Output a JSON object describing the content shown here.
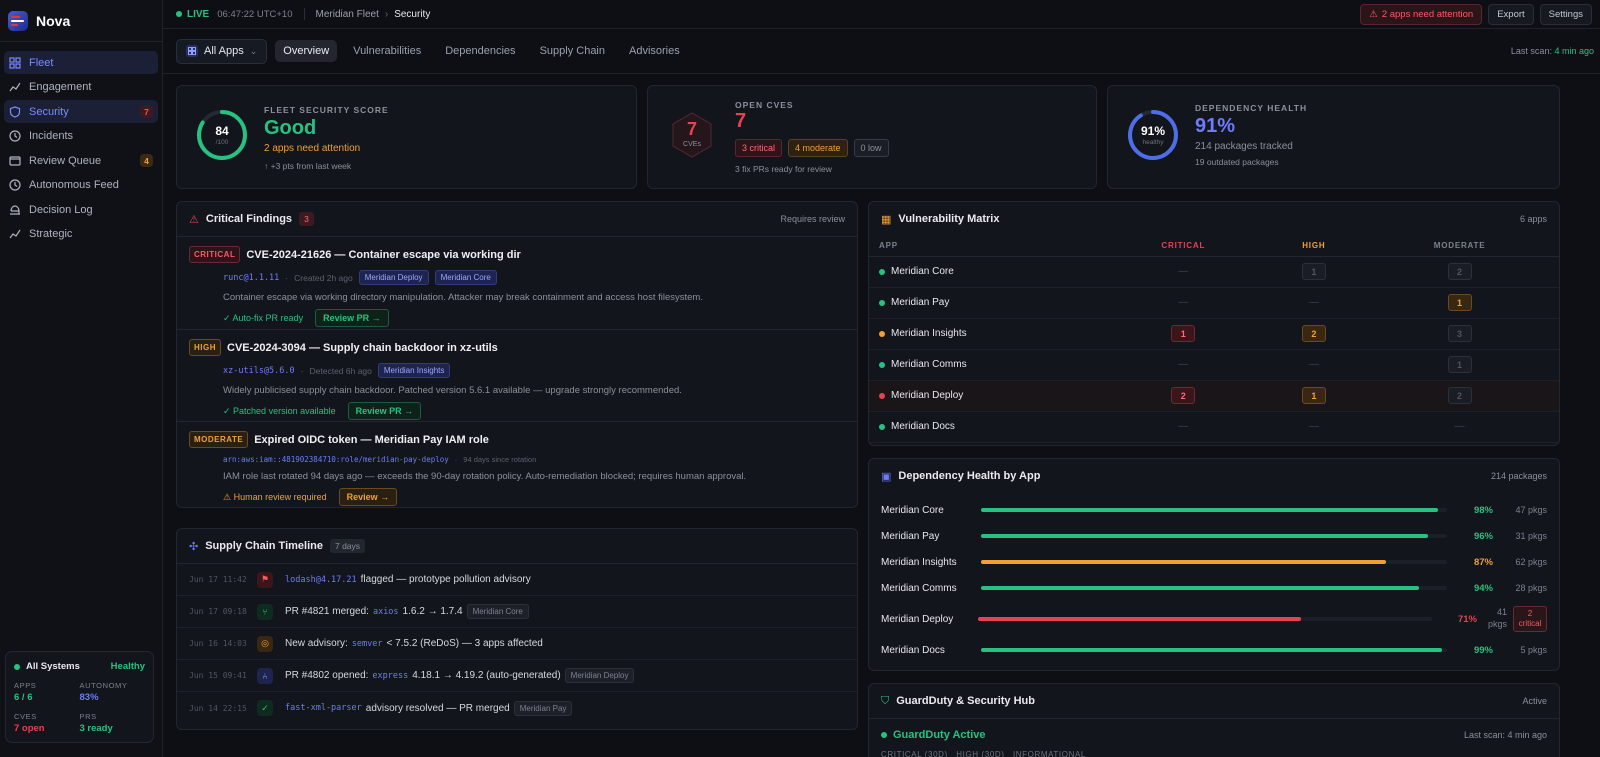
{
  "sidebar": {
    "brand": "Nova",
    "items": [
      {
        "label": "Fleet",
        "icon": "grid-icon",
        "active": true
      },
      {
        "label": "Engagement",
        "icon": "trend-icon"
      },
      {
        "label": "Security",
        "icon": "shield-icon",
        "badge": "7"
      },
      {
        "label": "Incidents",
        "icon": "clock-icon"
      },
      {
        "label": "Review Queue",
        "icon": "inbox-icon",
        "badge": "4"
      },
      {
        "label": "Autonomous Feed",
        "icon": "clock-icon"
      },
      {
        "label": "Decision Log",
        "icon": "scale-icon"
      },
      {
        "label": "Strategic",
        "icon": "trend-icon"
      }
    ],
    "systems": {
      "title": "All Systems",
      "status": "Healthy",
      "apps_label": "APPS",
      "apps": "6 / 6",
      "autonomy_label": "AUTONOMY",
      "autonomy": "83%",
      "cves_label": "CVES",
      "cves": "7 open",
      "prs_label": "PRS",
      "prs": "3 ready"
    }
  },
  "topbar": {
    "live": "LIVE",
    "time": "06:47:22 UTC+10",
    "crumb1": "Meridian Fleet",
    "crumb2": "Security",
    "attention": "2 apps need attention",
    "export": "Export",
    "settings": "Settings"
  },
  "tabs": {
    "selector": "All Apps",
    "items": [
      "Overview",
      "Vulnerabilities",
      "Dependencies",
      "Supply Chain",
      "Advisories"
    ],
    "last_scan_label": "Last scan:",
    "last_scan": "4 min ago"
  },
  "score": {
    "label": "FLEET SECURITY SCORE",
    "value": "Good",
    "sub": "2 apps need attention",
    "note": "↑ +3 pts from last week",
    "gauge": "84",
    "gauge_sub": "/100",
    "fraction": 0.84
  },
  "cves": {
    "label": "OPEN CVES",
    "value": "7",
    "hex": "7",
    "hex_sub": "CVEs",
    "critical": "3 critical",
    "moderate": "4 moderate",
    "low": "0 low",
    "note": "3 fix PRs ready for review"
  },
  "deps": {
    "label": "DEPENDENCY HEALTH",
    "value": "91%",
    "sub": "214 packages tracked",
    "note": "19 outdated packages",
    "gauge": "91%",
    "gauge_sub": "healthy",
    "fraction": 0.91
  },
  "findings": {
    "title": "Critical Findings",
    "count": "3",
    "right": "Requires review",
    "items": [
      {
        "sev": "CRITICAL",
        "title": "CVE-2024-21626 — Container escape via working dir",
        "pkg": "runc@1.1.11",
        "time": "Created 2h ago",
        "tags": [
          "Meridian Deploy",
          "Meridian Core"
        ],
        "desc": "Container escape via working directory manipulation. Attacker may break containment and access host filesystem.",
        "status": "✓ Auto-fix PR ready",
        "action": "Review PR →"
      },
      {
        "sev": "HIGH",
        "title": "CVE-2024-3094 — Supply chain backdoor in xz-utils",
        "pkg": "xz-utils@5.6.0",
        "time": "Detected 6h ago",
        "tags": [
          "Meridian Insights"
        ],
        "desc": "Widely publicised supply chain backdoor. Patched version 5.6.1 available — upgrade strongly recommended.",
        "status": "✓ Patched version available",
        "action": "Review PR →"
      },
      {
        "sev": "MODERATE",
        "title": "Expired OIDC token — Meridian Pay IAM role",
        "pkg": "arn:aws:iam::481902384710:role/meridian-pay-deploy",
        "time": "94 days since rotation",
        "tags": [],
        "desc": "IAM role last rotated 94 days ago — exceeds the 90-day rotation policy. Auto-remediation blocked; requires human approval.",
        "status": "⚠ Human review required",
        "action": "Review →"
      }
    ]
  },
  "timeline": {
    "title": "Supply Chain Timeline",
    "badge": "7 days",
    "rows": [
      {
        "time": "Jun 17 11:42",
        "pkg": "lodash@4.17.21",
        "text": "flagged — prototype pollution advisory",
        "tag": ""
      },
      {
        "time": "Jun 17 09:18",
        "pre": "PR #4821 merged:",
        "pkg": "axios",
        "text": "1.6.2 → 1.7.4",
        "tag": "Meridian Core"
      },
      {
        "time": "Jun 16 14:03",
        "pre": "New advisory:",
        "pkg": "semver",
        "text": "< 7.5.2 (ReDoS) — 3 apps affected",
        "tag": ""
      },
      {
        "time": "Jun 15 09:41",
        "pre": "PR #4802 opened:",
        "pkg": "express",
        "text": "4.18.1 → 4.19.2 (auto-generated)",
        "tag": "Meridian Deploy"
      },
      {
        "time": "Jun 14 22:15",
        "pkg": "fast-xml-parser",
        "text": "advisory resolved — PR merged",
        "tag": "Meridian Pay"
      }
    ]
  },
  "matrix": {
    "title": "Vulnerability Matrix",
    "right": "6 apps",
    "cols": [
      "APP",
      "CRITICAL",
      "HIGH",
      "MODERATE"
    ],
    "rows": [
      {
        "app": "Meridian Core",
        "dot": "#27c281",
        "c": "—",
        "h": "1",
        "m": "2"
      },
      {
        "app": "Meridian Pay",
        "dot": "#27c281",
        "c": "—",
        "h": "—",
        "m": "1"
      },
      {
        "app": "Meridian Insights",
        "dot": "#f3a032",
        "c": "1",
        "h": "2",
        "m": "3"
      },
      {
        "app": "Meridian Comms",
        "dot": "#27c281",
        "c": "—",
        "h": "—",
        "m": "1"
      },
      {
        "app": "Meridian Deploy",
        "dot": "#e8424f",
        "c": "2",
        "h": "1",
        "m": "2"
      },
      {
        "app": "Meridian Docs",
        "dot": "#27c281",
        "c": "—",
        "h": "—",
        "m": "—"
      }
    ]
  },
  "dephealth": {
    "title": "Dependency Health by App",
    "right": "214 packages",
    "rows": [
      {
        "app": "Meridian Core",
        "pct": "98%",
        "value": 98,
        "pkgs": "47 pkgs",
        "color": "#27c281"
      },
      {
        "app": "Meridian Pay",
        "pct": "96%",
        "value": 96,
        "pkgs": "31 pkgs",
        "color": "#27c281"
      },
      {
        "app": "Meridian Insights",
        "pct": "87%",
        "value": 87,
        "pkgs": "62 pkgs",
        "color": "#f3a032"
      },
      {
        "app": "Meridian Comms",
        "pct": "94%",
        "value": 94,
        "pkgs": "28 pkgs",
        "color": "#27c281"
      },
      {
        "app": "Meridian Deploy",
        "pct": "71%",
        "value": 71,
        "pkgs": "41 pkgs",
        "color": "#e8424f",
        "crit": "2 critical"
      },
      {
        "app": "Meridian Docs",
        "pct": "99%",
        "value": 99,
        "pkgs": "5 pkgs",
        "color": "#27c281"
      }
    ]
  },
  "guardduty": {
    "title": "GuardDuty & Security Hub",
    "right": "Active",
    "status": "GuardDuty Active",
    "scan": "Last scan: 4 min ago",
    "partial": "CRITICAL (30D)   HIGH (30D)   INFORMATIONAL"
  },
  "colors": {
    "accent": "#6d7cff",
    "green": "#27c281",
    "red": "#e8424f",
    "orange": "#f3a032"
  }
}
